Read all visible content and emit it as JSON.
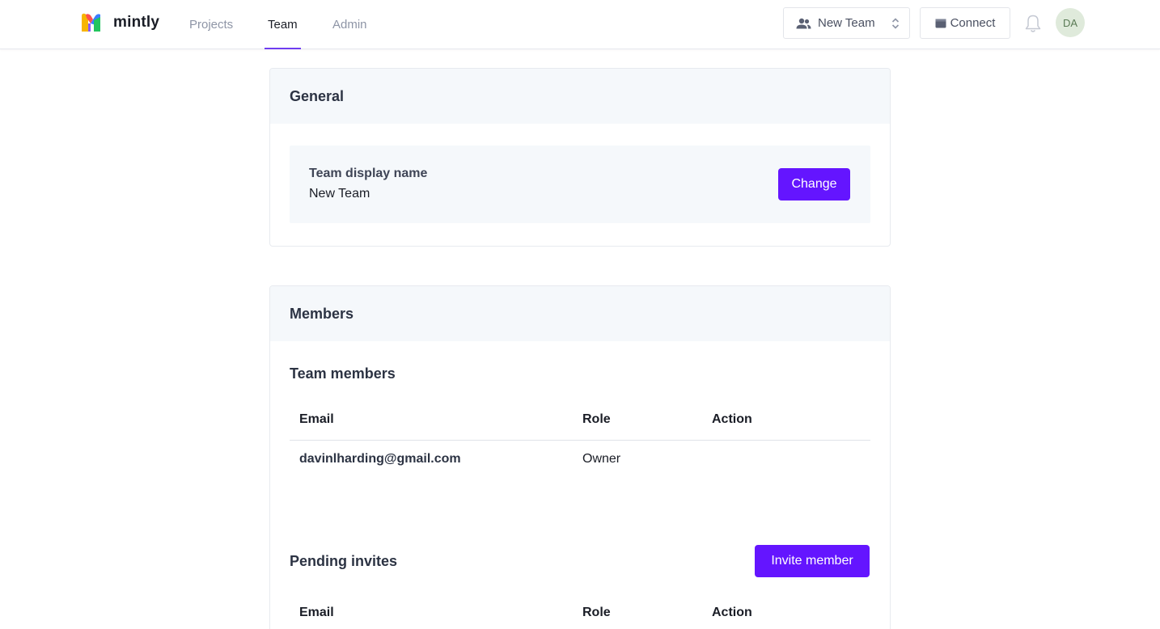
{
  "app": {
    "brand": "mintly",
    "brand_colors": [
      "#f7b500",
      "#ff4f4f",
      "#3c7dff",
      "#22c55e"
    ],
    "accent": "#6415ff"
  },
  "nav": {
    "tabs": [
      {
        "label": "Projects",
        "active": false
      },
      {
        "label": "Team",
        "active": true
      },
      {
        "label": "Admin",
        "active": false
      }
    ]
  },
  "header": {
    "team_switcher": {
      "label": "New Team",
      "icon": "users-icon",
      "chevron": "chevron-up-down-icon"
    },
    "connect": {
      "label": "Connect",
      "icon": "wallet-icon"
    },
    "notifications": {
      "icon": "bell-icon"
    },
    "avatar_initials": "DA"
  },
  "general": {
    "title": "General",
    "display_name_label": "Team display name",
    "display_name_value": "New Team",
    "change_label": "Change"
  },
  "members": {
    "title": "Members",
    "team_members_title": "Team members",
    "columns": [
      "Email",
      "Role",
      "Action"
    ],
    "rows": [
      {
        "email": "davinlharding@gmail.com",
        "role": "Owner",
        "action": ""
      }
    ],
    "pending_title": "Pending invites",
    "invite_label": "Invite member",
    "pending_columns": [
      "Email",
      "Role",
      "Action"
    ]
  }
}
